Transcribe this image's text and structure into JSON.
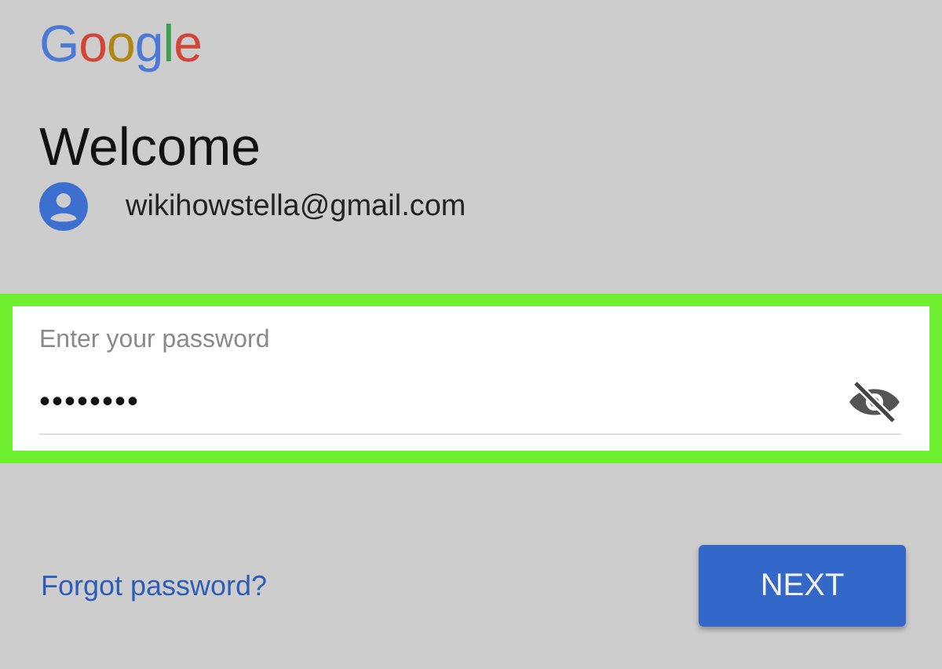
{
  "logo": [
    {
      "letter": "G",
      "color": "#4a7ad6"
    },
    {
      "letter": "o",
      "color": "#d34637"
    },
    {
      "letter": "o",
      "color": "#b08613"
    },
    {
      "letter": "g",
      "color": "#4a7ad6"
    },
    {
      "letter": "l",
      "color": "#3e9d4f"
    },
    {
      "letter": "e",
      "color": "#d34637"
    }
  ],
  "title": "Welcome",
  "account": {
    "email": "wikihowstella@gmail.com"
  },
  "password_field": {
    "label": "Enter your password",
    "value": "••••••••",
    "highlighted": true
  },
  "forgot_link": "Forgot password?",
  "next_button": "NEXT"
}
